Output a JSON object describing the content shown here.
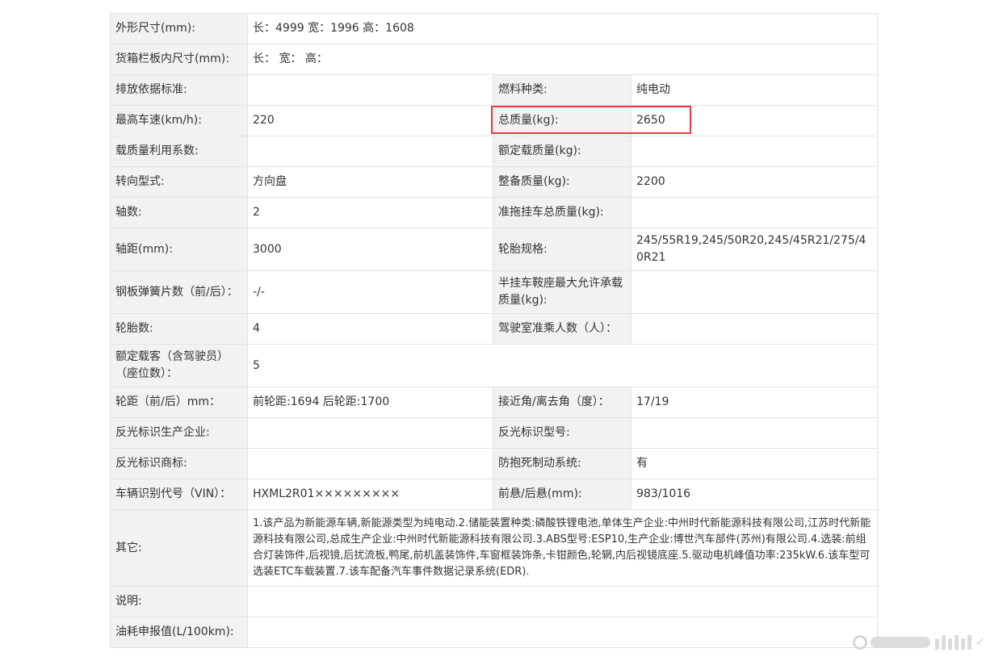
{
  "rows": [
    {
      "l1": "外形尺寸(mm):",
      "v1": "长：4999 宽：1996 高：1608"
    },
    {
      "l1": "货箱栏板内尺寸(mm):",
      "v1": "长：  宽：  高："
    },
    {
      "l1": "排放依据标准:",
      "v1": "",
      "l2": "燃料种类:",
      "v2": "纯电动"
    },
    {
      "l1": "最高车速(km/h):",
      "v1": "220",
      "l2": "总质量(kg):",
      "v2": "2650"
    },
    {
      "l1": "载质量利用系数:",
      "v1": "",
      "l2": "额定载质量(kg):",
      "v2": ""
    },
    {
      "l1": "转向型式:",
      "v1": "方向盘",
      "l2": "整备质量(kg):",
      "v2": "2200"
    },
    {
      "l1": "轴数:",
      "v1": "2",
      "l2": "准拖挂车总质量(kg):",
      "v2": ""
    },
    {
      "l1": "轴距(mm):",
      "v1": "3000",
      "l2": "轮胎规格:",
      "v2": "245/55R19,245/50R20,245/45R21/275/40R21"
    },
    {
      "l1": "钢板弹簧片数（前/后）：",
      "v1": "-/-",
      "l2": "半挂车鞍座最大允许承载质量(kg):",
      "v2": ""
    },
    {
      "l1": "轮胎数:",
      "v1": "4",
      "l2": "驾驶室准乘人数（人）：",
      "v2": ""
    },
    {
      "l1": "额定载客（含驾驶员）（座位数）：",
      "v1": "5"
    },
    {
      "l1": "轮距（前/后）mm：",
      "v1": "前轮距:1694 后轮距:1700",
      "l2": "接近角/离去角（度）：",
      "v2": "17/19"
    },
    {
      "l1": "反光标识生产企业:",
      "v1": "",
      "l2": "反光标识型号:",
      "v2": ""
    },
    {
      "l1": "反光标识商标:",
      "v1": "",
      "l2": "防抱死制动系统:",
      "v2": "有"
    },
    {
      "l1": "车辆识别代号（VIN）：",
      "v1": "HXML2R01×××××××××",
      "l2": "前悬/后悬(mm):",
      "v2": "983/1016"
    },
    {
      "l1": "其它:",
      "v1": "1.该产品为新能源车辆,新能源类型为纯电动.2.储能装置种类:磷酸铁锂电池,单体生产企业:中州时代新能源科技有限公司,江苏时代新能源科技有限公司,总成生产企业:中州时代新能源科技有限公司.3.ABS型号:ESP10,生产企业:博世汽车部件(苏州)有限公司.4.选装:前组合灯装饰件,后视镜,后扰流板,鸭尾,前机盖装饰件,车窗框装饰条,卡钳颜色,轮辋,内后视镜底座.5.驱动电机峰值功率:235kW.6.该车型可选装ETC车载装置.7.该车配备汽车事件数据记录系统(EDR)."
    },
    {
      "l1": "说明:",
      "v1": ""
    },
    {
      "l1": "油耗申报值(L/100km):",
      "v1": ""
    }
  ],
  "colors": {
    "label_bg": "#f2f2f2",
    "border": "#e3e3e3",
    "highlight": "#e53b46",
    "text": "#333333"
  }
}
